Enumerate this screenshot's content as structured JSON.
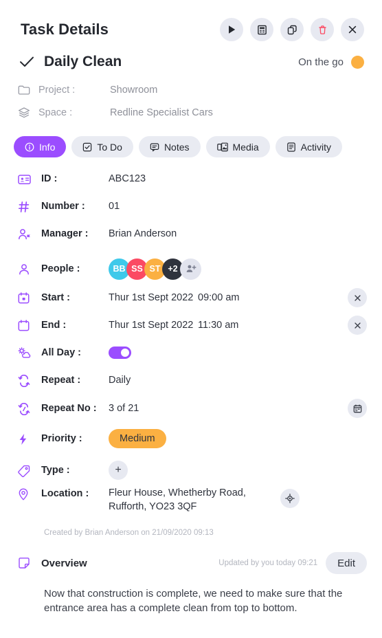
{
  "header": {
    "title": "Task Details",
    "actions": [
      {
        "name": "play-button",
        "icon": "play-icon"
      },
      {
        "name": "invoice-button",
        "icon": "invoice-icon"
      },
      {
        "name": "duplicate-button",
        "icon": "copy-icon"
      },
      {
        "name": "delete-button",
        "icon": "trash-icon"
      },
      {
        "name": "close-button",
        "icon": "close-icon"
      }
    ]
  },
  "task": {
    "name": "Daily Clean",
    "status": "On the go",
    "status_color": "#FBB042",
    "check_icon": "check-icon"
  },
  "meta": [
    {
      "icon": "folder-icon",
      "label": "Project :",
      "value": "Showroom"
    },
    {
      "icon": "layers-icon",
      "label": "Space :",
      "value": "Redline Specialist Cars"
    }
  ],
  "tabs": [
    {
      "label": "Info",
      "icon": "info-icon",
      "active": true
    },
    {
      "label": "To Do",
      "icon": "checkbox-icon",
      "active": false
    },
    {
      "label": "Notes",
      "icon": "comment-icon",
      "active": false
    },
    {
      "label": "Media",
      "icon": "media-icon",
      "active": false
    },
    {
      "label": "Activity",
      "icon": "activity-icon",
      "active": false
    }
  ],
  "fields": {
    "id": {
      "label": "ID :",
      "value": "ABC123",
      "icon": "id-card-icon"
    },
    "number": {
      "label": "Number :",
      "value": "01",
      "icon": "hash-icon"
    },
    "manager": {
      "label": "Manager :",
      "value": "Brian Anderson",
      "icon": "manager-icon"
    },
    "people": {
      "label": "People :",
      "icon": "person-icon",
      "avatars": [
        {
          "initials": "BB",
          "color": "#3EC9EA"
        },
        {
          "initials": "SS",
          "color": "#FB4A63"
        },
        {
          "initials": "ST",
          "color": "#FBB042"
        },
        {
          "initials": "+2",
          "color": "#2F333D"
        }
      ],
      "add_label": "add-person"
    },
    "start": {
      "label": "Start :",
      "date": "Thur 1st Sept 2022",
      "time": "09:00 am",
      "icon": "calendar-start-icon",
      "clear": "×"
    },
    "end": {
      "label": "End :",
      "date": "Thur 1st Sept 2022",
      "time": "11:30 am",
      "icon": "calendar-end-icon",
      "clear": "×"
    },
    "all_day": {
      "label": "All Day :",
      "icon": "weather-icon",
      "on": true
    },
    "repeat": {
      "label": "Repeat :",
      "value": "Daily",
      "icon": "repeat-icon"
    },
    "repeat_no": {
      "label": "Repeat No :",
      "value": "3 of 21",
      "icon": "repeat-no-icon"
    },
    "priority": {
      "label": "Priority :",
      "value": "Medium",
      "icon": "bolt-icon",
      "color": "#FBB042"
    },
    "type": {
      "label": "Type :",
      "add": "+",
      "icon": "tag-icon"
    },
    "location": {
      "label": "Location :",
      "value": "Fleur House, Whetherby Road, Rufforth, YO23 3QF",
      "icon": "pin-icon"
    }
  },
  "created": "Created by Brian Anderson on 21/09/2020 09:13",
  "overview": {
    "title": "Overview",
    "icon": "note-icon",
    "updated": "Updated by you today 09:21",
    "edit_label": "Edit",
    "body": "Now that construction is complete, we need to make sure that the entrance area has a complete clean from top to bottom."
  },
  "theme": {
    "accent": "#9B4DFF",
    "danger": "#FB4A63",
    "chip_bg": "#E7E9F1"
  }
}
